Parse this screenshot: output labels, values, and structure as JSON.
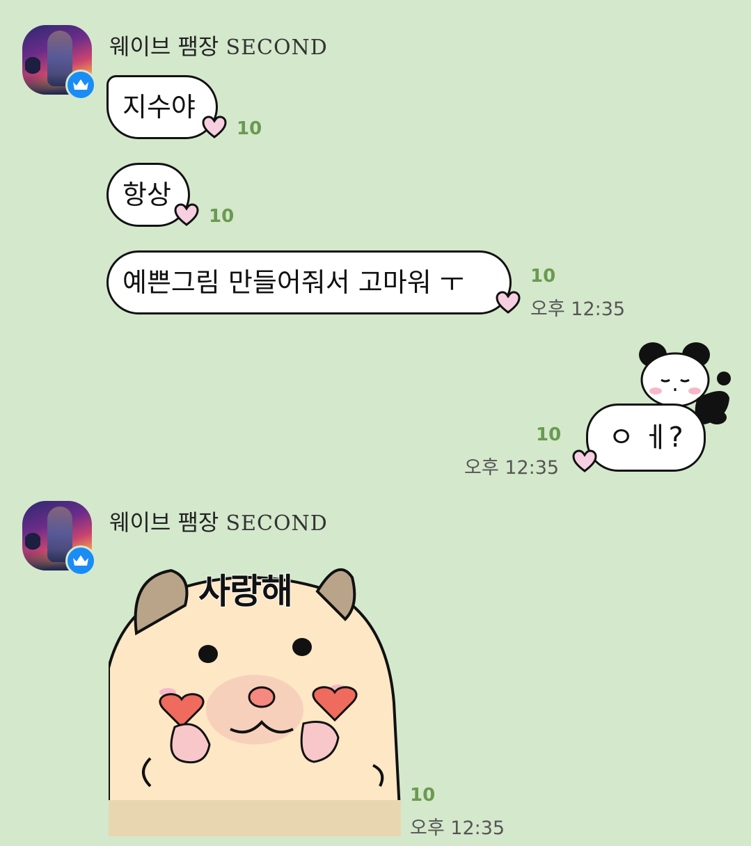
{
  "messages_top": {
    "sender": {
      "name": "웨이브 팸장",
      "name_suffix": "SECOND"
    },
    "bubbles": [
      {
        "text": "지수야",
        "count": "10"
      },
      {
        "text": "항상",
        "count": "10"
      },
      {
        "text": "예쁜그림 만들어줘서 고마워 ㅜ",
        "count": "10",
        "time": "오후 12:35"
      }
    ]
  },
  "my_message": {
    "text": "ㅇ ㅔ?",
    "count": "10",
    "time": "오후 12:35"
  },
  "messages_bottom": {
    "sender": {
      "name": "웨이브 팸장",
      "name_suffix": "SECOND"
    },
    "sticker": {
      "text": "사랑해",
      "count": "10",
      "time": "오후 12:35"
    }
  },
  "colors": {
    "background": "#d4e8cc",
    "count": "#6a9a50",
    "badge": "#1a8cf5",
    "heart": "#f6cfe0"
  },
  "icons": {
    "badge": "crown-icon",
    "reaction": "heart-icon"
  }
}
